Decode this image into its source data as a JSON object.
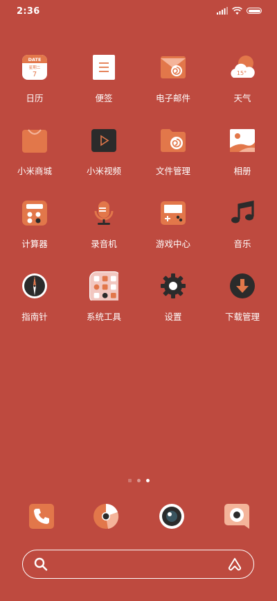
{
  "status_bar": {
    "time": "2:36"
  },
  "apps": [
    {
      "label": "日历",
      "icon": "calendar-icon",
      "calendar_month": "DATE",
      "calendar_weekday": "星期二",
      "calendar_day": "7"
    },
    {
      "label": "便签",
      "icon": "notes-icon"
    },
    {
      "label": "电子邮件",
      "icon": "email-icon"
    },
    {
      "label": "天气",
      "icon": "weather-icon",
      "temperature": "15°"
    },
    {
      "label": "小米商城",
      "icon": "mi-store-icon"
    },
    {
      "label": "小米视频",
      "icon": "video-icon"
    },
    {
      "label": "文件管理",
      "icon": "file-manager-icon"
    },
    {
      "label": "相册",
      "icon": "gallery-icon"
    },
    {
      "label": "计算器",
      "icon": "calculator-icon"
    },
    {
      "label": "录音机",
      "icon": "recorder-icon"
    },
    {
      "label": "游戏中心",
      "icon": "game-center-icon"
    },
    {
      "label": "音乐",
      "icon": "music-icon"
    },
    {
      "label": "指南针",
      "icon": "compass-icon"
    },
    {
      "label": "系统工具",
      "icon": "system-tools-folder-icon"
    },
    {
      "label": "设置",
      "icon": "settings-icon"
    },
    {
      "label": "下载管理",
      "icon": "download-manager-icon"
    }
  ],
  "dock": [
    {
      "icon": "phone-icon"
    },
    {
      "icon": "browser-icon"
    },
    {
      "icon": "camera-icon"
    },
    {
      "icon": "messages-icon"
    }
  ],
  "page_indicator": {
    "count": 3,
    "active": 3
  },
  "search": {
    "placeholder": ""
  },
  "colors": {
    "background": "#BE4A3F",
    "icon_orange": "#E2774A",
    "icon_dark": "#2B2B2B",
    "icon_light": "#FFFFFF",
    "icon_peach": "#F4B49A"
  }
}
